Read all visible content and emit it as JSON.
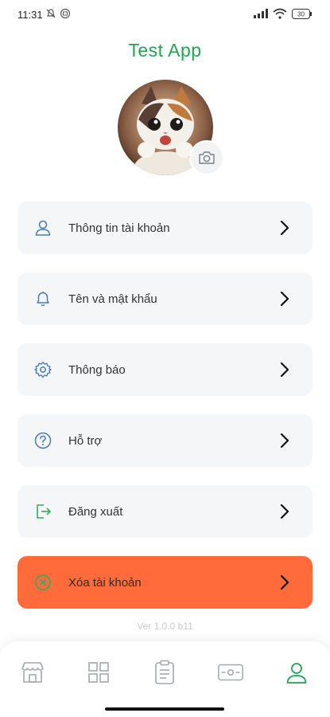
{
  "status": {
    "time": "11:31",
    "battery": "30"
  },
  "app": {
    "title": "Test App"
  },
  "menu": [
    {
      "label": "Thông tin tài khoản",
      "icon": "user-icon"
    },
    {
      "label": "Tên và mật khẩu",
      "icon": "bell-icon"
    },
    {
      "label": "Thông báo",
      "icon": "gear-icon"
    },
    {
      "label": "Hỗ trợ",
      "icon": "help-icon"
    },
    {
      "label": "Đăng xuất",
      "icon": "logout-icon"
    },
    {
      "label": "Xóa tài khoản",
      "icon": "delete-circle-icon"
    }
  ],
  "version": "Ver 1.0.0 b11",
  "bottom_nav": [
    {
      "icon": "store-icon"
    },
    {
      "icon": "grid-icon"
    },
    {
      "icon": "clipboard-icon"
    },
    {
      "icon": "card-icon"
    },
    {
      "icon": "profile-icon",
      "active": true
    }
  ],
  "colors": {
    "brand": "#22a455",
    "danger": "#ff6b3a",
    "icon_blue": "#4a7bb5"
  }
}
